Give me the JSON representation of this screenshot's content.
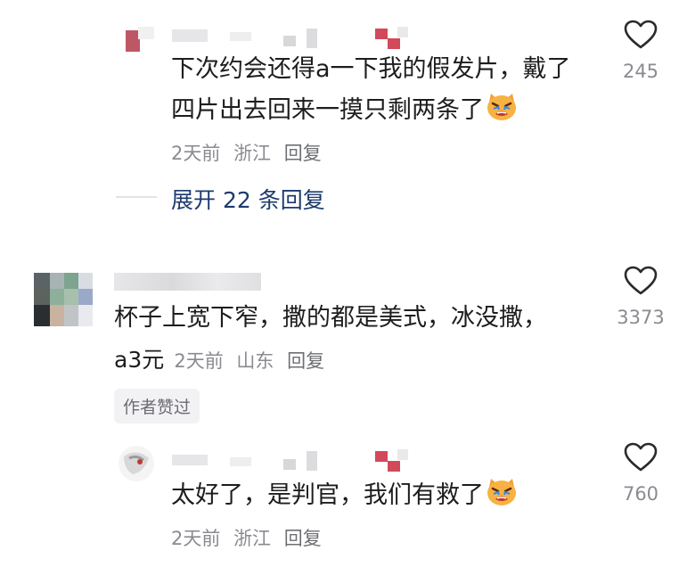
{
  "comments": [
    {
      "text_line1": "下次约会还得a一下我的假发片，戴了",
      "text_line2": "四片出去回来一摸只剩两条了",
      "emoji": "crying-cat-emoji",
      "time": "2天前",
      "location": "浙江",
      "reply": "回复",
      "likes": "245"
    },
    {
      "text_line1": "杯子上宽下窄，撒的都是美式，冰没撒，",
      "text_line2_prefix": "a3元",
      "time": "2天前",
      "location": "山东",
      "reply": "回复",
      "likes": "3373",
      "author_tag": "作者赞过"
    },
    {
      "text_line1": "太好了，是判官，我们有救了",
      "emoji": "crying-cat-emoji",
      "time": "2天前",
      "location": "浙江",
      "reply": "回复",
      "likes": "760"
    }
  ],
  "expand_replies": "展开 22 条回复",
  "colors": {
    "text": "#1d1d1f",
    "meta": "#8a8b91",
    "expand": "#1d3a6e",
    "heart_stroke": "#2a2a2e",
    "tag_bg": "#f2f2f4"
  }
}
